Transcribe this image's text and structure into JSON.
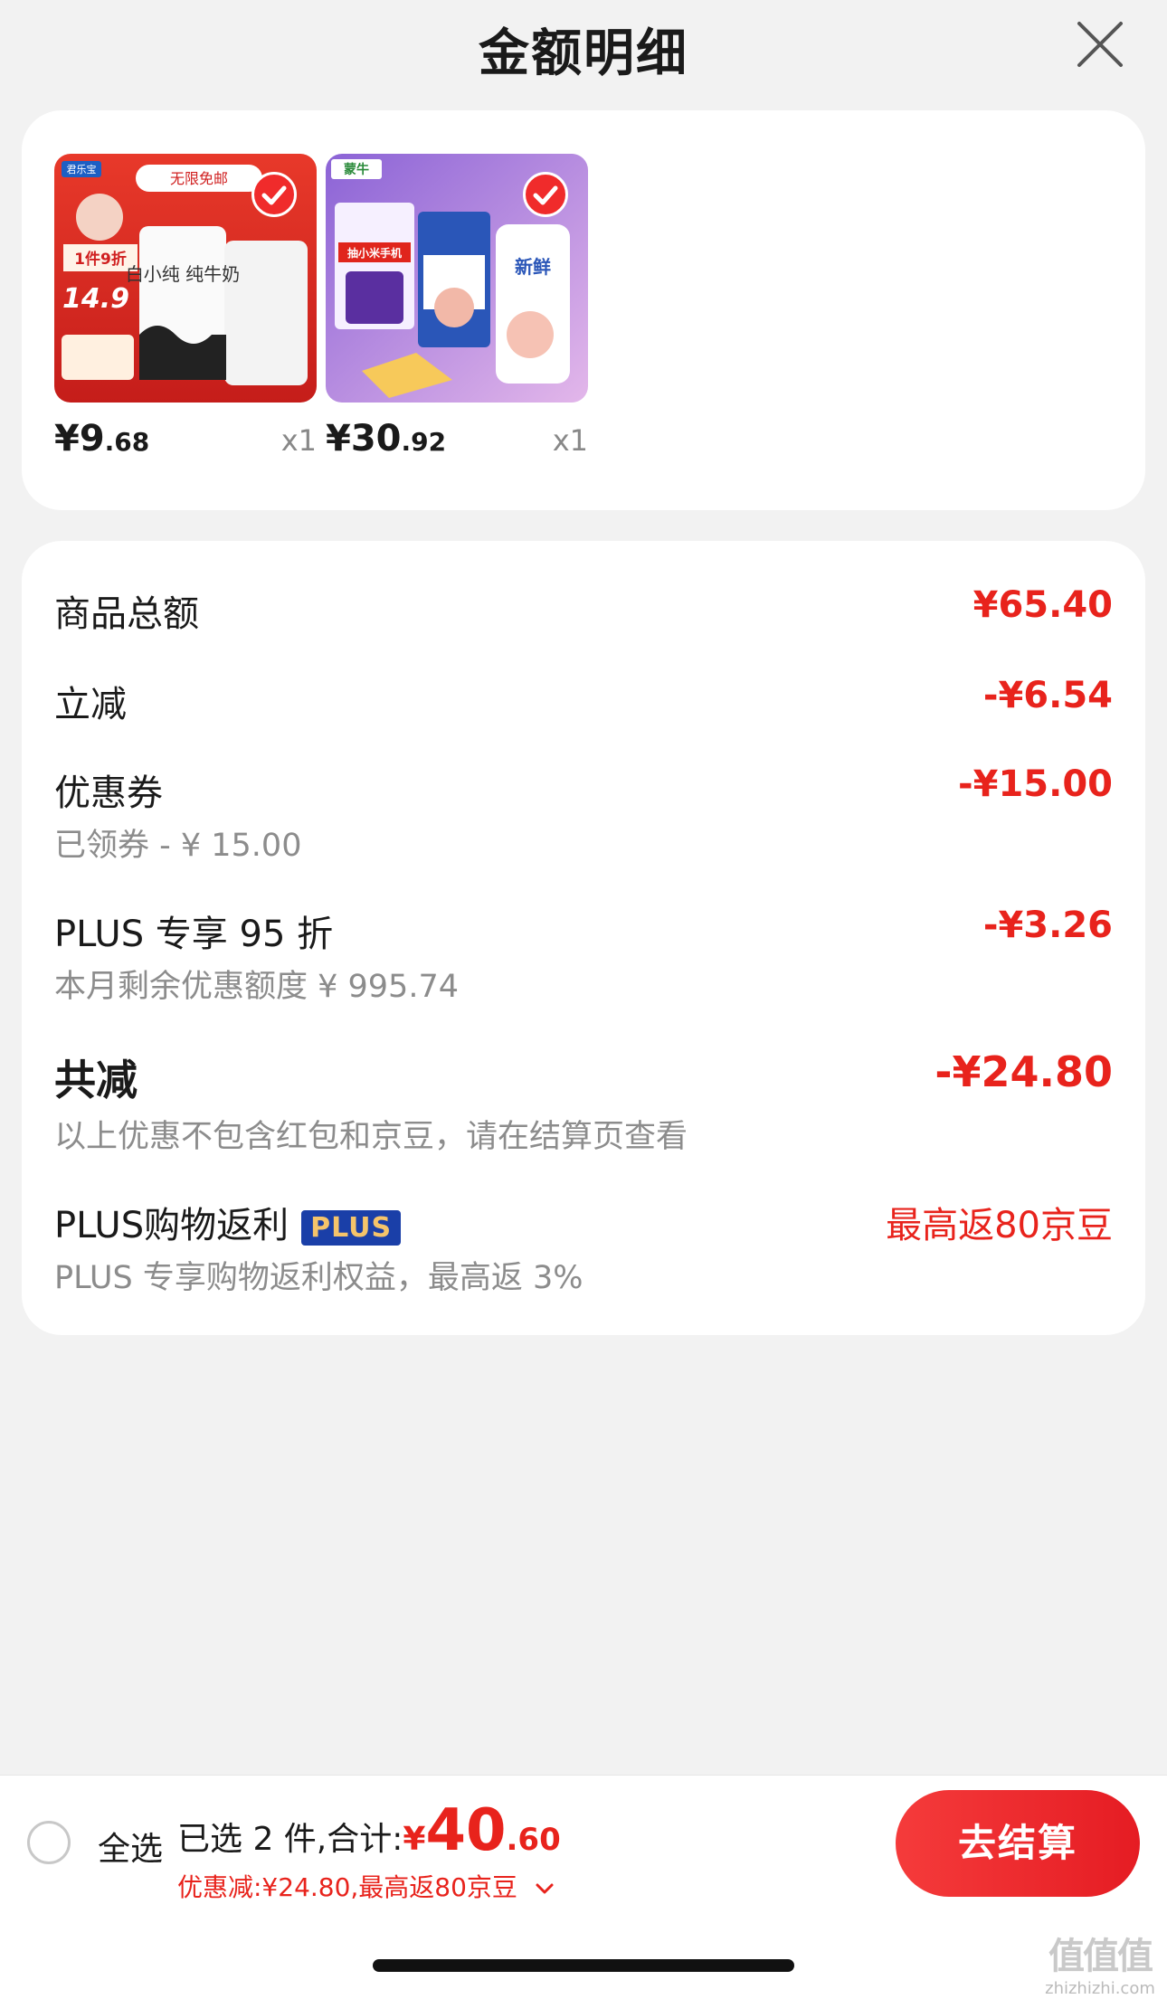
{
  "header": {
    "title": "金额明细"
  },
  "products": [
    {
      "price_main": "¥9",
      "price_cents": ".68",
      "qty": "x1",
      "thumb_tag": "1件9折",
      "thumb_price": "14.9",
      "thumb_name": "白小纯 纯牛奶",
      "brand": "君乐宝"
    },
    {
      "price_main": "¥30",
      "price_cents": ".92",
      "qty": "x1",
      "thumb_tag": "抽小米手机",
      "thumb_name": "新鲜",
      "brand": "蒙牛"
    }
  ],
  "details": {
    "goods_total": {
      "label": "商品总额",
      "value": "¥65.40"
    },
    "instant_discount": {
      "label": "立减",
      "value": "-¥6.54"
    },
    "coupon": {
      "label": "优惠券",
      "sub": "已领券 - ¥ 15.00",
      "value": "-¥15.00"
    },
    "plus_discount": {
      "label": "PLUS 专享 95 折",
      "sub": "本月剩余优惠额度 ¥ 995.74",
      "value": "-¥3.26"
    },
    "total_reduction": {
      "label": "共减",
      "sub": "以上优惠不包含红包和京豆，请在结算页查看",
      "value": "-¥24.80"
    },
    "plus_rebate": {
      "label": "PLUS购物返利",
      "badge": "PLUS",
      "sub": "PLUS 专享购物返利权益，最高返 3%",
      "value": "最高返80京豆"
    }
  },
  "bottom": {
    "select_all": "全选",
    "selected_text": "已选 2 件,合计:",
    "total_symbol": "¥",
    "total_int": "40",
    "total_dec": ".60",
    "discount_line": "优惠减:¥24.80,最高返80京豆",
    "checkout": "去结算"
  },
  "watermark": {
    "mark": "值值值",
    "text": "zhizhizhi.com"
  },
  "colors": {
    "accent": "#e8231c",
    "checkout": "#f0302b",
    "plus_badge": "#1a3fa8"
  }
}
